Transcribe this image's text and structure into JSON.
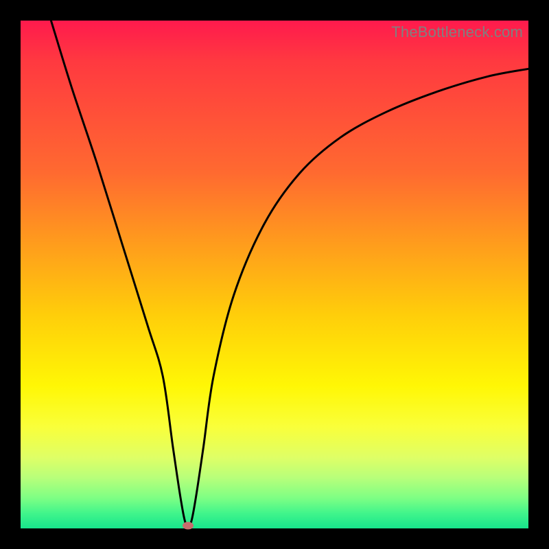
{
  "watermark": "TheBottleneck.com",
  "chart_data": {
    "type": "line",
    "title": "",
    "xlabel": "",
    "ylabel": "",
    "xlim": [
      0,
      100
    ],
    "ylim": [
      0,
      100
    ],
    "series": [
      {
        "name": "bottleneck-curve",
        "x": [
          6,
          10,
          15,
          20,
          25,
          28,
          30,
          31.5,
          32.5,
          33.5,
          34.5,
          36,
          38,
          42,
          48,
          55,
          63,
          72,
          82,
          92,
          100
        ],
        "y": [
          100,
          87,
          72,
          56,
          40,
          30,
          16,
          6,
          1,
          1,
          6,
          16,
          30,
          46,
          60,
          70,
          77,
          82,
          86,
          89,
          90.5
        ]
      }
    ],
    "marker": {
      "x": 33,
      "y": 0.5,
      "color": "#c76d6d"
    },
    "background_gradient": {
      "stops": [
        {
          "pos": 0.0,
          "color": "#ff1a4d"
        },
        {
          "pos": 0.3,
          "color": "#ff6a30"
        },
        {
          "pos": 0.58,
          "color": "#ffce0a"
        },
        {
          "pos": 0.8,
          "color": "#f9ff3a"
        },
        {
          "pos": 1.0,
          "color": "#17e58c"
        }
      ]
    }
  }
}
